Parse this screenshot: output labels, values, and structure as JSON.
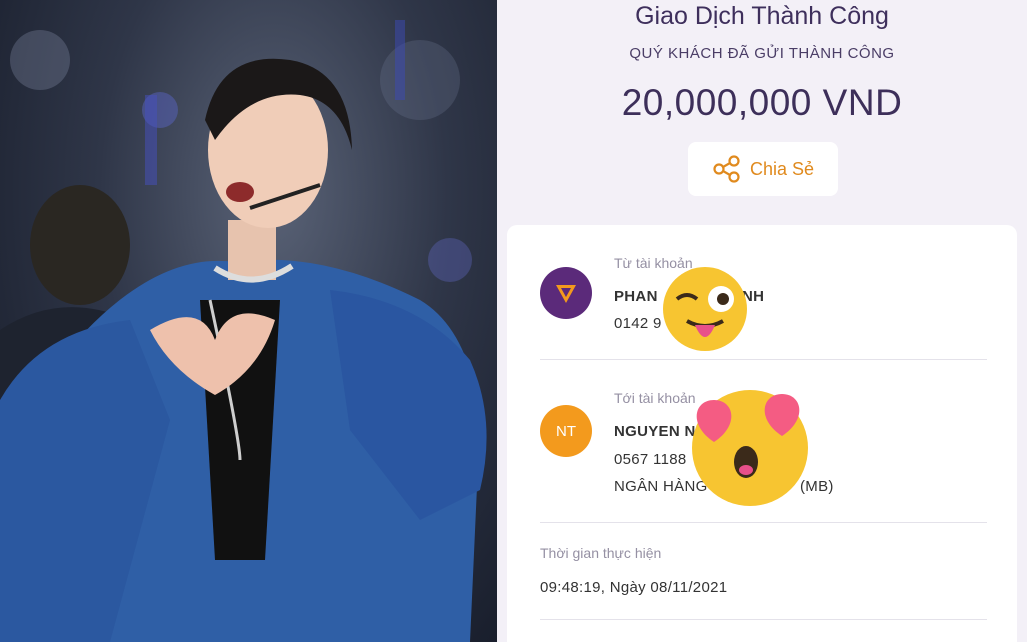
{
  "photo": {
    "subject": "performer-photo"
  },
  "receipt": {
    "title": "Giao Dịch Thành Công",
    "subtitle": "QUÝ KHÁCH ĐÃ GỬI THÀNH CÔNG",
    "amount": "20,000,000 VND",
    "share_label": "Chia Sẻ",
    "from": {
      "label": "Từ tài khoản",
      "name": "PHAN",
      "name_tail": "NH",
      "account": "0142 9"
    },
    "to": {
      "label": "Tới tài khoản",
      "avatar_initials": "NT",
      "name": "NGUYEN N",
      "account": "0567 1188",
      "bank_prefix": "NGÂN HÀNG",
      "bank_suffix": "(MB)"
    },
    "time": {
      "label": "Thời gian thực hiện",
      "value": "09:48:19, Ngày 08/11/2021"
    }
  },
  "colors": {
    "accent_orange": "#e08a1e",
    "title_purple": "#3e2f5c",
    "background": "#f3f0f7"
  },
  "icons": [
    "share-icon",
    "app-logo-icon",
    "winking-tongue-emoji",
    "heart-eyes-emoji"
  ]
}
